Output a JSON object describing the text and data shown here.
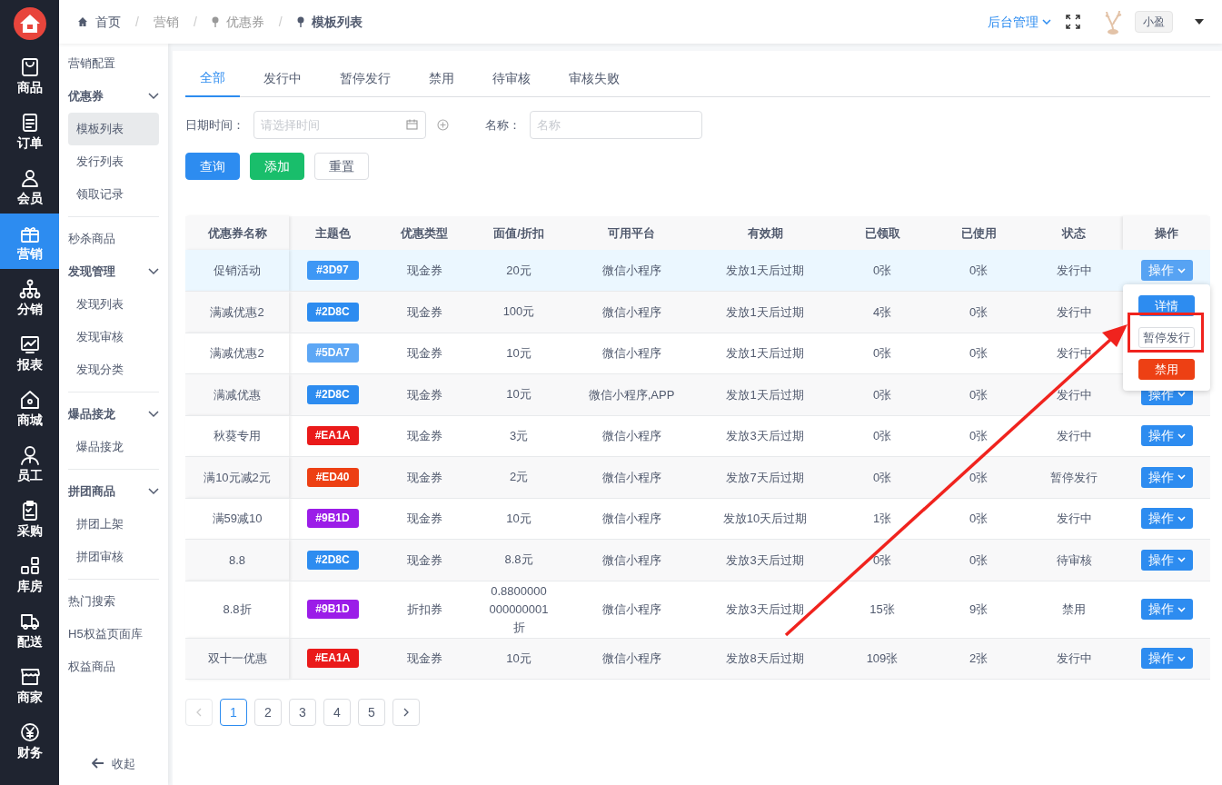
{
  "rail": {
    "items": [
      {
        "label": "商品",
        "selected": false
      },
      {
        "label": "订单",
        "selected": false
      },
      {
        "label": "会员",
        "selected": false
      },
      {
        "label": "营销",
        "selected": true
      },
      {
        "label": "分销",
        "selected": false
      },
      {
        "label": "报表",
        "selected": false
      },
      {
        "label": "商城",
        "selected": false
      },
      {
        "label": "员工",
        "selected": false
      },
      {
        "label": "采购",
        "selected": false
      },
      {
        "label": "库房",
        "selected": false
      },
      {
        "label": "配送",
        "selected": false
      },
      {
        "label": "商家",
        "selected": false
      },
      {
        "label": "财务",
        "selected": false
      }
    ]
  },
  "breadcrumb": [
    "首页",
    "营销",
    "优惠券",
    "模板列表"
  ],
  "breadcrumb_separator": "/",
  "header": {
    "menu": "后台管理",
    "user": "小盈"
  },
  "submenu": {
    "sections": [
      [
        {
          "kind": "link",
          "label": "营销配置",
          "selected": false
        },
        {
          "kind": "group",
          "label": "优惠券",
          "expanded": true,
          "children": [
            {
              "label": "模板列表",
              "selected": true
            },
            {
              "label": "发行列表",
              "selected": false
            },
            {
              "label": "领取记录",
              "selected": false
            }
          ]
        }
      ],
      [
        {
          "kind": "link",
          "label": "秒杀商品",
          "selected": false
        },
        {
          "kind": "group",
          "label": "发现管理",
          "expanded": true,
          "children": [
            {
              "label": "发现列表",
              "selected": false
            },
            {
              "label": "发现审核",
              "selected": false
            },
            {
              "label": "发现分类",
              "selected": false
            }
          ]
        }
      ],
      [
        {
          "kind": "group",
          "label": "爆品接龙",
          "expanded": true,
          "children": [
            {
              "label": "爆品接龙",
              "selected": false
            }
          ]
        }
      ],
      [
        {
          "kind": "group",
          "label": "拼团商品",
          "expanded": true,
          "children": [
            {
              "label": "拼团上架",
              "selected": false
            },
            {
              "label": "拼团审核",
              "selected": false
            }
          ]
        }
      ],
      [
        {
          "kind": "link",
          "label": "热门搜索",
          "selected": false
        },
        {
          "kind": "link",
          "label": "H5权益页面库",
          "selected": false
        },
        {
          "kind": "link",
          "label": "权益商品",
          "selected": false
        }
      ]
    ],
    "collapse": "收起"
  },
  "tabs": [
    {
      "label": "全部",
      "selected": true
    },
    {
      "label": "发行中",
      "selected": false
    },
    {
      "label": "暂停发行",
      "selected": false
    },
    {
      "label": "禁用",
      "selected": false
    },
    {
      "label": "待审核",
      "selected": false
    },
    {
      "label": "审核失败",
      "selected": false
    }
  ],
  "filters": [
    {
      "kind": "date",
      "label": "日期时间：",
      "placeholder": "请选择时间"
    },
    {
      "kind": "text",
      "label": "名称：",
      "placeholder": "名称"
    }
  ],
  "buttons": [
    {
      "kind": "primary",
      "label": "查询"
    },
    {
      "kind": "success",
      "label": "添加"
    },
    {
      "kind": "default",
      "label": "重置"
    }
  ],
  "table": {
    "columns": [
      "优惠券名称",
      "主题色",
      "优惠类型",
      "面值/折扣",
      "可用平台",
      "有效期",
      "已领取",
      "已使用",
      "状态",
      "操作"
    ],
    "rows": [
      {
        "name": "促销活动",
        "theme": {
          "text": "#3D97",
          "color": "#3d97f5"
        },
        "type": "现金券",
        "value": "20元",
        "platform": "微信小程序",
        "validity": "发放1天后过期",
        "claimed": "0张",
        "used": "0张",
        "status": "发行中",
        "action": "操作",
        "hovered": true,
        "dropdown": [
          {
            "kind": "primary",
            "label": "详情"
          },
          {
            "kind": "default",
            "label": "暂停发行"
          },
          {
            "kind": "danger",
            "label": "禁用"
          }
        ]
      },
      {
        "name": "满减优惠2",
        "theme": {
          "text": "#2D8C",
          "color": "#2d8cf0"
        },
        "type": "现金券",
        "value": "100元",
        "platform": "微信小程序",
        "validity": "发放1天后过期",
        "claimed": "4张",
        "used": "0张",
        "status": "发行中",
        "hovered": false
      },
      {
        "name": "满减优惠2",
        "theme": {
          "text": "#5DA7",
          "color": "#5da7f5"
        },
        "type": "现金券",
        "value": "10元",
        "platform": "微信小程序",
        "validity": "发放1天后过期",
        "claimed": "0张",
        "used": "0张",
        "status": "发行中",
        "hovered": false
      },
      {
        "name": "满减优惠",
        "theme": {
          "text": "#2D8C",
          "color": "#2d8cf0"
        },
        "type": "现金券",
        "value": "10元",
        "platform": "微信小程序,APP",
        "validity": "发放1天后过期",
        "claimed": "0张",
        "used": "0张",
        "status": "发行中",
        "action": "操作",
        "hovered": false
      },
      {
        "name": "秋葵专用",
        "theme": {
          "text": "#EA1A",
          "color": "#ea1a1a"
        },
        "type": "现金券",
        "value": "3元",
        "platform": "微信小程序",
        "validity": "发放3天后过期",
        "claimed": "0张",
        "used": "0张",
        "status": "发行中",
        "action": "操作",
        "hovered": false
      },
      {
        "name": "满10元减2元",
        "theme": {
          "text": "#ED40",
          "color": "#ed4014"
        },
        "type": "现金券",
        "value": "2元",
        "platform": "微信小程序",
        "validity": "发放7天后过期",
        "claimed": "0张",
        "used": "0张",
        "status": "暂停发行",
        "action": "操作",
        "hovered": false
      },
      {
        "name": "满59减10",
        "theme": {
          "text": "#9B1D",
          "color": "#9b1de8"
        },
        "type": "现金券",
        "value": "10元",
        "platform": "微信小程序",
        "validity": "发放10天后过期",
        "claimed": "1张",
        "used": "0张",
        "status": "发行中",
        "action": "操作",
        "hovered": false
      },
      {
        "name": "8.8",
        "theme": {
          "text": "#2D8C",
          "color": "#2d8cf0"
        },
        "type": "现金券",
        "value": "8.8元",
        "platform": "微信小程序",
        "validity": "发放3天后过期",
        "claimed": "0张",
        "used": "0张",
        "status": "待审核",
        "action": "操作",
        "hovered": false
      },
      {
        "name": "8.8折",
        "theme": {
          "text": "#9B1D",
          "color": "#9b1de8"
        },
        "type": "折扣券",
        "value": "0.8800000000000001折",
        "platform": "微信小程序",
        "validity": "发放3天后过期",
        "claimed": "15张",
        "used": "9张",
        "status": "禁用",
        "action": "操作",
        "hovered": false
      },
      {
        "name": "双十一优惠",
        "theme": {
          "text": "#EA1A",
          "color": "#ea1a1a"
        },
        "type": "现金券",
        "value": "10元",
        "platform": "微信小程序",
        "validity": "发放8天后过期",
        "claimed": "109张",
        "used": "2张",
        "status": "发行中",
        "action": "操作",
        "hovered": false
      }
    ]
  },
  "pagination": {
    "prev_disabled": true,
    "next_disabled": false,
    "pages": [
      {
        "label": "1",
        "selected": true
      },
      {
        "label": "2",
        "selected": false
      },
      {
        "label": "3",
        "selected": false
      },
      {
        "label": "4",
        "selected": false
      },
      {
        "label": "5",
        "selected": false
      }
    ]
  }
}
